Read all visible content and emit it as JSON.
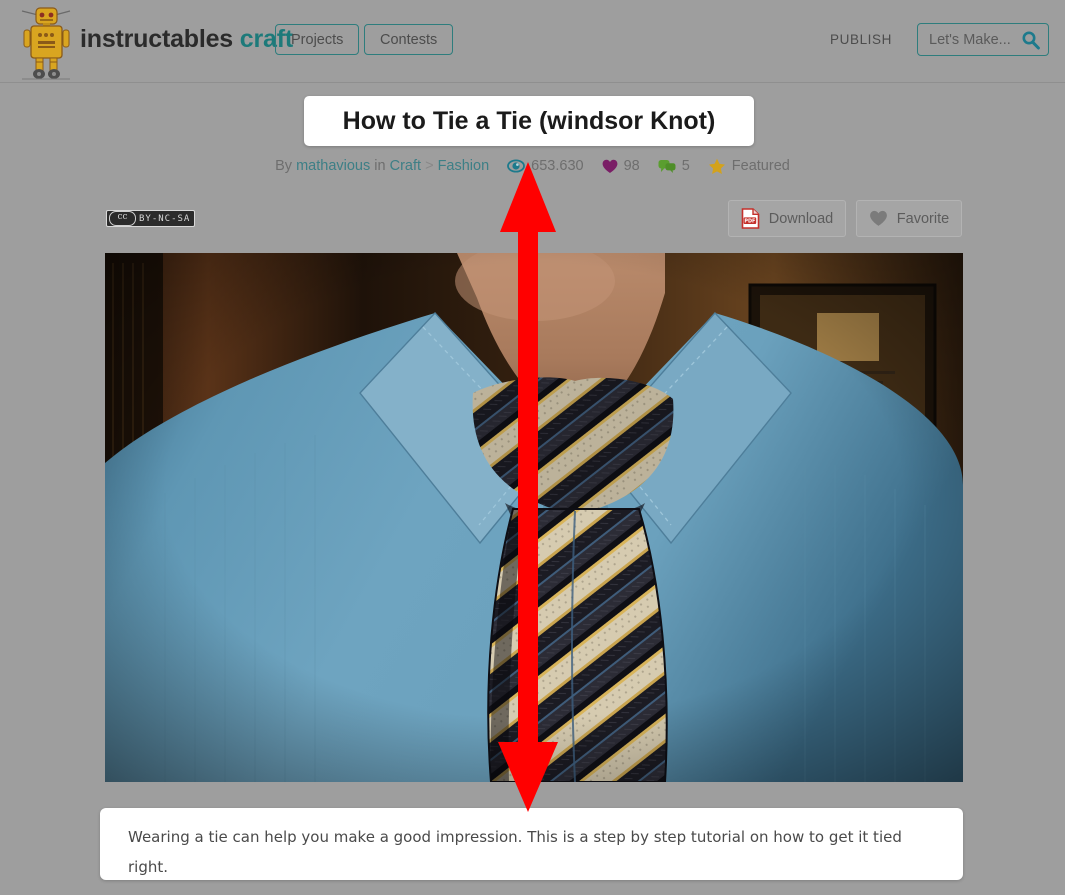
{
  "header": {
    "logo_name": "instructables-robot-logo",
    "brand_main": "instructables",
    "brand_sub": "craft",
    "nav": [
      {
        "label": "Projects"
      },
      {
        "label": "Contests"
      }
    ],
    "publish_label": "PUBLISH",
    "search": {
      "placeholder": "Let's Make...",
      "value": "",
      "icon": "search-icon"
    },
    "colors": {
      "background": "#9e9e9e",
      "accent_teal": "#1d7a7a",
      "text": "#4c4c4c"
    }
  },
  "article": {
    "title": "How to Tie a Tie (windsor Knot)",
    "byline": {
      "prefix": "By",
      "author": "mathavious",
      "in_word": "in",
      "category": "Craft",
      "separator": ">",
      "subcategory": "Fashion"
    },
    "stats": {
      "views_icon": "eye-icon",
      "views": "653.630",
      "favorites_icon": "heart-icon",
      "favorites": "98",
      "comments_icon": "comment-icon",
      "comments": "5",
      "featured_icon": "star-icon",
      "featured_label": "Featured"
    },
    "license": {
      "cc_mark": "cc",
      "terms": "BY-NC-SA"
    },
    "actions": [
      {
        "name": "download",
        "label": "Download",
        "icon": "pdf-icon"
      },
      {
        "name": "favorite",
        "label": "Favorite",
        "icon": "heart-icon"
      }
    ],
    "hero_image": {
      "alt": "Close-up of a man wearing a light blue dress shirt with a striped tie tied in a windsor knot",
      "name": "hero-photo"
    },
    "caption": "Wearing a tie can help you make a good impression.  This is a step by step tutorial on how to get it tied right."
  },
  "annotation": {
    "type": "double-headed-vertical-arrow",
    "color": "#ff0000",
    "name": "red-measurement-arrow"
  },
  "stat_colors": {
    "eye": "#1d7a8c",
    "heart": "#7a1e66",
    "comment": "#5a9e2f",
    "star": "#d3a21c",
    "pdf": "#c4302b"
  }
}
